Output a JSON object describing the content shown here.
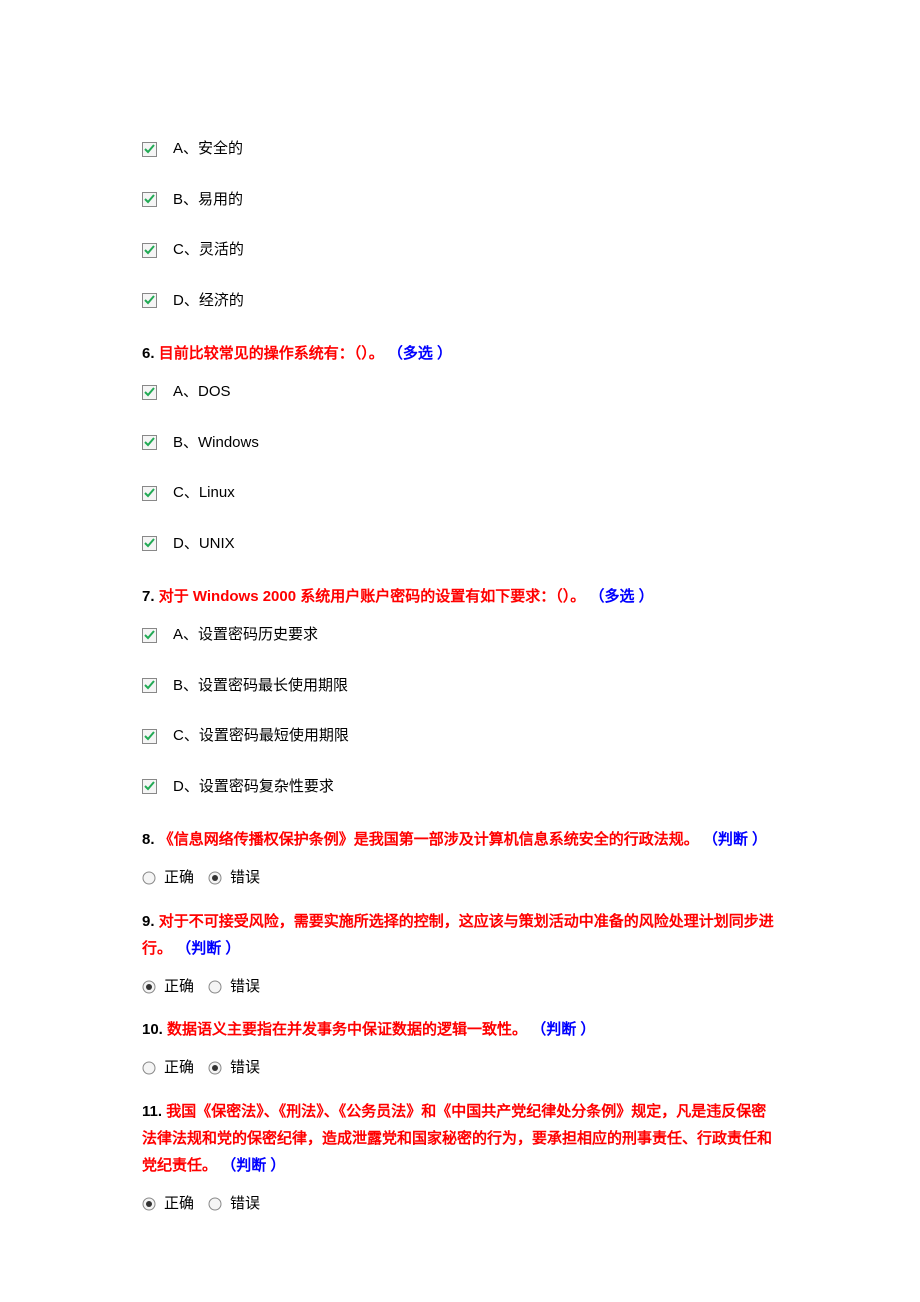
{
  "q5": {
    "opts": {
      "a": "A、安全的",
      "b": "B、易用的",
      "c": "C、灵活的",
      "d": "D、经济的"
    }
  },
  "q6": {
    "num": "6.",
    "text": "目前比较常见的操作系统有：（）。",
    "type": "（多选 ）",
    "opts": {
      "a": "A、DOS",
      "b": "B、Windows",
      "c": "C、Linux",
      "d": "D、UNIX"
    }
  },
  "q7": {
    "num": "7.",
    "text": "对于 Windows 2000 系统用户账户密码的设置有如下要求：（）。",
    "type": "（多选 ）",
    "opts": {
      "a": "A、设置密码历史要求",
      "b": "B、设置密码最长使用期限",
      "c": "C、设置密码最短使用期限",
      "d": "D、设置密码复杂性要求"
    }
  },
  "q8": {
    "num": "8.",
    "text": "《信息网络传播权保护条例》是我国第一部涉及计算机信息系统安全的行政法规。",
    "type": "（判断 ）"
  },
  "q9": {
    "num": "9.",
    "text": "对于不可接受风险，需要实施所选择的控制，这应该与策划活动中准备的风险处理计划同步进行。",
    "type": "（判断 ）"
  },
  "q10": {
    "num": "10.",
    "text": "数据语义主要指在并发事务中保证数据的逻辑一致性。",
    "type": "（判断 ）"
  },
  "q11": {
    "num": "11.",
    "text": "我国《保密法》、《刑法》、《公务员法》和《中国共产党纪律处分条例》规定，凡是违反保密法律法规和党的保密纪律，造成泄露党和国家秘密的行为，要承担相应的刑事责任、行政责任和党纪责任。",
    "type": "（判断 ）"
  },
  "tf": {
    "true": "正确",
    "false": "错误"
  }
}
